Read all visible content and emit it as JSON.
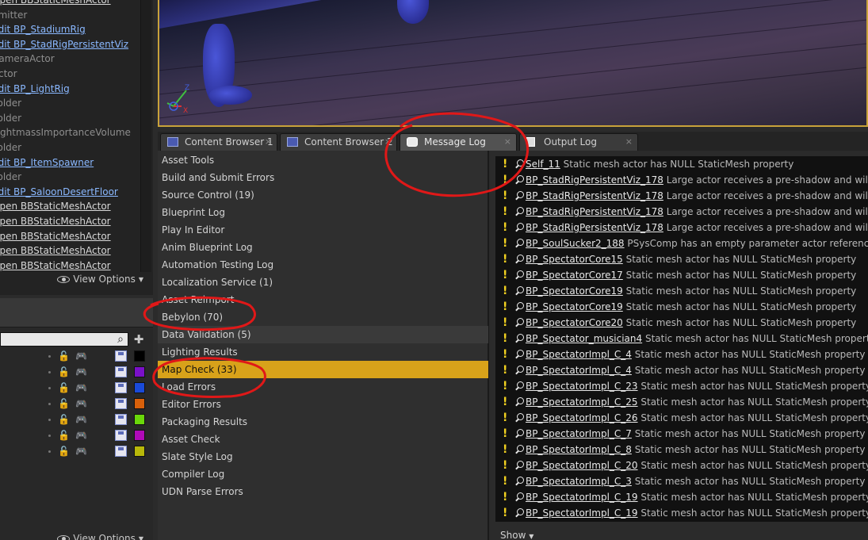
{
  "outliner": {
    "items": [
      {
        "label": "Open BBStaticMeshActor",
        "style": "open"
      },
      {
        "label": "Emitter",
        "style": "plain"
      },
      {
        "label": "Edit BP_StadiumRig",
        "style": "link"
      },
      {
        "label": "Edit BP_StadRigPersistentViz",
        "style": "link"
      },
      {
        "label": "CameraActor",
        "style": "plain"
      },
      {
        "label": "Actor",
        "style": "plain"
      },
      {
        "label": "Edit BP_LightRig",
        "style": "link"
      },
      {
        "label": "Folder",
        "style": "plain"
      },
      {
        "label": "Folder",
        "style": "plain"
      },
      {
        "label": "LightmassImportanceVolume",
        "style": "plain"
      },
      {
        "label": "Folder",
        "style": "plain"
      },
      {
        "label": "Edit BP_ItemSpawner",
        "style": "link"
      },
      {
        "label": "Folder",
        "style": "plain"
      },
      {
        "label": "Edit BP_SaloonDesertFloor",
        "style": "link"
      },
      {
        "label": "Open BBStaticMeshActor",
        "style": "open"
      },
      {
        "label": "Open BBStaticMeshActor",
        "style": "open"
      },
      {
        "label": "Open BBStaticMeshActor",
        "style": "open"
      },
      {
        "label": "Open BBStaticMeshActor",
        "style": "open"
      },
      {
        "label": "Open BBStaticMeshActor",
        "style": "open"
      }
    ],
    "view_options": "View Options"
  },
  "layers": {
    "search_placeholder": "",
    "view_options": "View Options",
    "rows": [
      {
        "color": "#000000"
      },
      {
        "color": "#7a10c8"
      },
      {
        "color": "#1a4ad8"
      },
      {
        "color": "#d8600a"
      },
      {
        "color": "#6ad80a"
      },
      {
        "color": "#b00ab8"
      },
      {
        "color": "#b8b80a"
      }
    ]
  },
  "tabs": [
    {
      "label": "Content Browser 1",
      "icon": "content-browser-icon",
      "close": "×"
    },
    {
      "label": "Content Browser 2",
      "icon": "content-browser-icon",
      "close": "×"
    },
    {
      "label": "Message Log",
      "icon": "message-log-icon",
      "close": "×"
    },
    {
      "label": "Output Log",
      "icon": "output-log-icon",
      "close": "×"
    }
  ],
  "categories": [
    {
      "label": "Asset Tools",
      "state": ""
    },
    {
      "label": "Build and Submit Errors",
      "state": ""
    },
    {
      "label": "Source Control (19)",
      "state": ""
    },
    {
      "label": "Blueprint Log",
      "state": ""
    },
    {
      "label": "Play In Editor",
      "state": ""
    },
    {
      "label": "Anim Blueprint Log",
      "state": ""
    },
    {
      "label": "Automation Testing Log",
      "state": ""
    },
    {
      "label": "Localization Service (1)",
      "state": ""
    },
    {
      "label": "Asset Reimport",
      "state": ""
    },
    {
      "label": "Bebylon (70)",
      "state": ""
    },
    {
      "label": "Data Validation (5)",
      "state": "hover"
    },
    {
      "label": "Lighting Results",
      "state": ""
    },
    {
      "label": "Map Check (33)",
      "state": "sel"
    },
    {
      "label": "Load Errors",
      "state": ""
    },
    {
      "label": "Editor Errors",
      "state": ""
    },
    {
      "label": "Packaging Results",
      "state": ""
    },
    {
      "label": "Asset Check",
      "state": ""
    },
    {
      "label": "Slate Style Log",
      "state": ""
    },
    {
      "label": "Compiler Log",
      "state": ""
    },
    {
      "label": "UDN Parse Errors",
      "state": ""
    }
  ],
  "messages": [
    {
      "actor": "Self_11",
      "text": " Static mesh actor has NULL StaticMesh property"
    },
    {
      "actor": "BP_StadRigPersistentViz_178",
      "text": " Large actor receives a pre-shadow and will cause an"
    },
    {
      "actor": "BP_StadRigPersistentViz_178",
      "text": " Large actor receives a pre-shadow and will cause an"
    },
    {
      "actor": "BP_StadRigPersistentViz_178",
      "text": " Large actor receives a pre-shadow and will cause an"
    },
    {
      "actor": "BP_StadRigPersistentViz_178",
      "text": " Large actor receives a pre-shadow and will cause an"
    },
    {
      "actor": "BP_SoulSucker2_188",
      "text": " PSysComp has an empty parameter actor reference at index"
    },
    {
      "actor": "BP_SpectatorCore15",
      "text": " Static mesh actor has NULL StaticMesh property"
    },
    {
      "actor": "BP_SpectatorCore17",
      "text": " Static mesh actor has NULL StaticMesh property"
    },
    {
      "actor": "BP_SpectatorCore19",
      "text": " Static mesh actor has NULL StaticMesh property"
    },
    {
      "actor": "BP_SpectatorCore19",
      "text": " Static mesh actor has NULL StaticMesh property"
    },
    {
      "actor": "BP_SpectatorCore20",
      "text": " Static mesh actor has NULL StaticMesh property"
    },
    {
      "actor": "BP_Spectator_musician4",
      "text": " Static mesh actor has NULL StaticMesh property"
    },
    {
      "actor": "BP_SpectatorImpl_C_4",
      "text": " Static mesh actor has NULL StaticMesh property"
    },
    {
      "actor": "BP_SpectatorImpl_C_4",
      "text": " Static mesh actor has NULL StaticMesh property"
    },
    {
      "actor": "BP_SpectatorImpl_C_23",
      "text": " Static mesh actor has NULL StaticMesh property"
    },
    {
      "actor": "BP_SpectatorImpl_C_25",
      "text": " Static mesh actor has NULL StaticMesh property"
    },
    {
      "actor": "BP_SpectatorImpl_C_26",
      "text": " Static mesh actor has NULL StaticMesh property"
    },
    {
      "actor": "BP_SpectatorImpl_C_7",
      "text": " Static mesh actor has NULL StaticMesh property"
    },
    {
      "actor": "BP_SpectatorImpl_C_8",
      "text": " Static mesh actor has NULL StaticMesh property"
    },
    {
      "actor": "BP_SpectatorImpl_C_20",
      "text": " Static mesh actor has NULL StaticMesh property"
    },
    {
      "actor": "BP_SpectatorImpl_C_3",
      "text": " Static mesh actor has NULL StaticMesh property"
    },
    {
      "actor": "BP_SpectatorImpl_C_19",
      "text": " Static mesh actor has NULL StaticMesh property"
    },
    {
      "actor": "BP_SpectatorImpl_C_19",
      "text": " Static mesh actor has NULL StaticMesh property"
    }
  ],
  "show_button": "Show",
  "viewport": {
    "axis_z": "Z",
    "axis_x": "X"
  },
  "colors": {
    "selection": "#d8a21a",
    "annotation": "#e01818",
    "warning": "#f0d020"
  }
}
